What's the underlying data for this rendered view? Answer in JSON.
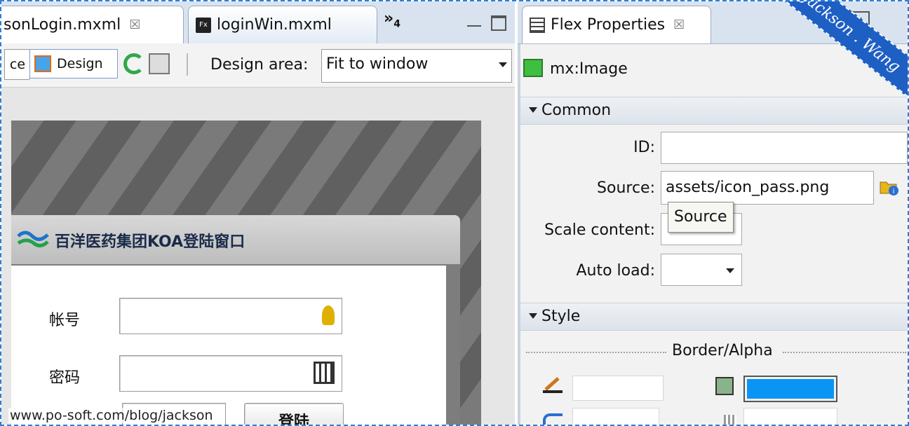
{
  "editor": {
    "tabs": [
      {
        "label": "sonLogin.mxml",
        "close": "☒"
      },
      {
        "label": "loginWin.mxml"
      },
      {
        "label": "»",
        "count": "4"
      }
    ],
    "toolbar": {
      "source_btn": "ce",
      "design_btn": "Design",
      "design_area_label": "Design area:",
      "design_area_value": "Fit to window"
    },
    "login": {
      "title": "百洋医药集团KOA登陆窗口",
      "account_label": "帐号",
      "password_label": "密码",
      "login_button": "登陆"
    },
    "watermark": "www.po-soft.com/blog/jackson"
  },
  "properties": {
    "tab_label": "Flex Properties",
    "tab_close": "☒",
    "component": "mx:Image",
    "sections": {
      "common": "Common",
      "style": "Style"
    },
    "fields": {
      "id_label": "ID:",
      "id_value": "",
      "source_label": "Source:",
      "source_value": "assets/icon_pass.png",
      "scale_label": "Scale content:",
      "autoload_label": "Auto load:"
    },
    "tooltip": "Source",
    "border_alpha": "Border/Alpha",
    "colors": {
      "fill": "#0a95f5"
    },
    "ribbon": "Jackson . Wang"
  }
}
